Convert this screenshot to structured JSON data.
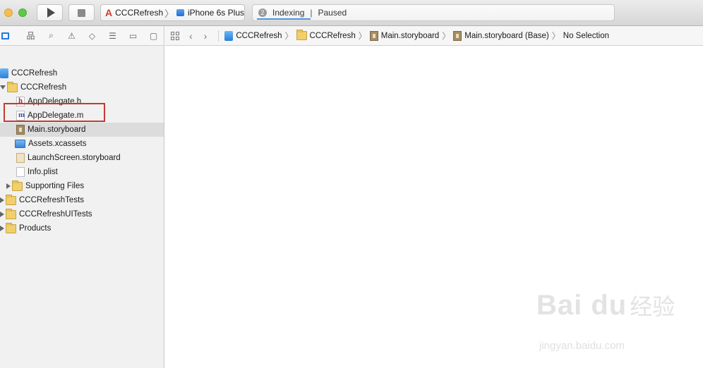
{
  "toolbar": {
    "scheme_name": "CCCRefresh",
    "device_name": "iPhone 6s Plus",
    "activity_count": "2",
    "activity_status": "Indexing",
    "activity_separator": "|",
    "activity_state": "Paused"
  },
  "navigator": {
    "tabs": [
      "project-navigator-icon",
      "symbol-navigator-icon",
      "find-navigator-icon",
      "issue-navigator-icon",
      "test-navigator-icon",
      "debug-navigator-icon",
      "breakpoint-navigator-icon",
      "report-navigator-icon"
    ],
    "items": [
      {
        "label": "CCCRefresh",
        "kind": "project"
      },
      {
        "label": "CCCRefresh",
        "kind": "folder"
      },
      {
        "label": "AppDelegate.h",
        "kind": "header",
        "letter": "h"
      },
      {
        "label": "AppDelegate.m",
        "kind": "source",
        "letter": "m"
      },
      {
        "label": "Main.storyboard",
        "kind": "storyboard"
      },
      {
        "label": "Assets.xcassets",
        "kind": "assets"
      },
      {
        "label": "LaunchScreen.storyboard",
        "kind": "storyboard"
      },
      {
        "label": "Info.plist",
        "kind": "plist"
      },
      {
        "label": "Supporting Files",
        "kind": "folder"
      },
      {
        "label": "CCCRefreshTests",
        "kind": "folder"
      },
      {
        "label": "CCCRefreshUITests",
        "kind": "folder"
      },
      {
        "label": "Products",
        "kind": "folder"
      }
    ]
  },
  "jumpbar": {
    "crumbs": [
      "CCCRefresh",
      "CCCRefresh",
      "Main.storyboard",
      "Main.storyboard (Base)",
      "No Selection"
    ]
  },
  "watermark": {
    "logo": "Bai du",
    "cn": "经验",
    "url": "jingyan.baidu.com"
  }
}
